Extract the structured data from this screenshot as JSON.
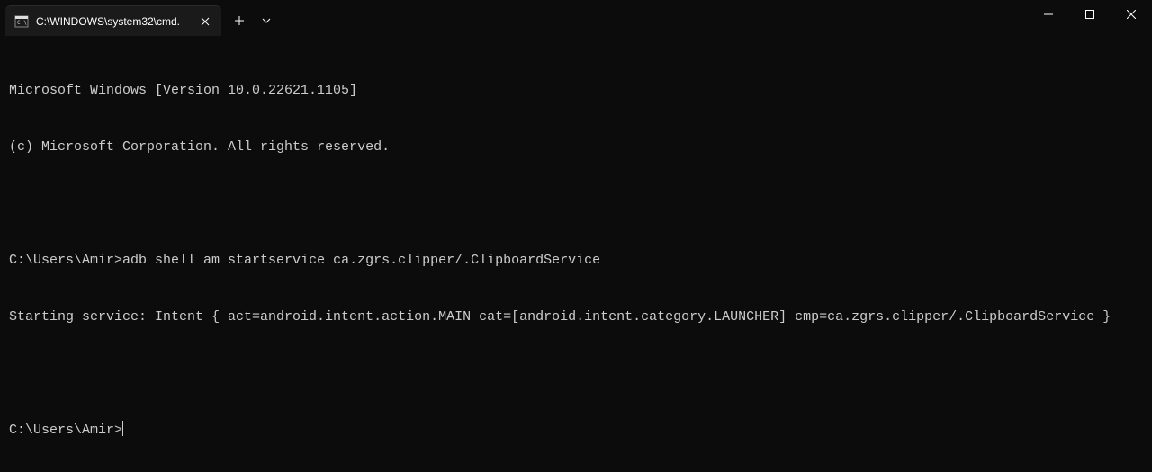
{
  "titlebar": {
    "tab_title": "C:\\WINDOWS\\system32\\cmd.",
    "new_tab_label": "+",
    "close_tab_label": "×"
  },
  "terminal": {
    "line1": "Microsoft Windows [Version 10.0.22621.1105]",
    "line2": "(c) Microsoft Corporation. All rights reserved.",
    "blank1": " ",
    "prompt1": "C:\\Users\\Amir>",
    "cmd1": "adb shell am startservice ca.zgrs.clipper/.ClipboardService",
    "output1": "Starting service: Intent { act=android.intent.action.MAIN cat=[android.intent.category.LAUNCHER] cmp=ca.zgrs.clipper/.ClipboardService }",
    "blank2": " ",
    "prompt2": "C:\\Users\\Amir>"
  }
}
